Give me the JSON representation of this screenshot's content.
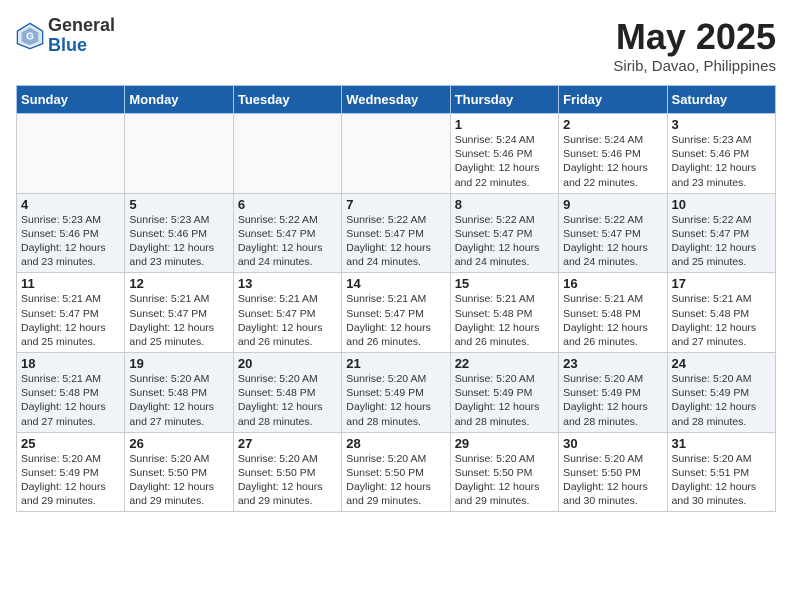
{
  "header": {
    "logo_general": "General",
    "logo_blue": "Blue",
    "month_title": "May 2025",
    "location": "Sirib, Davao, Philippines"
  },
  "days_of_week": [
    "Sunday",
    "Monday",
    "Tuesday",
    "Wednesday",
    "Thursday",
    "Friday",
    "Saturday"
  ],
  "weeks": [
    [
      {
        "day": "",
        "info": ""
      },
      {
        "day": "",
        "info": ""
      },
      {
        "day": "",
        "info": ""
      },
      {
        "day": "",
        "info": ""
      },
      {
        "day": "1",
        "info": "Sunrise: 5:24 AM\nSunset: 5:46 PM\nDaylight: 12 hours\nand 22 minutes."
      },
      {
        "day": "2",
        "info": "Sunrise: 5:24 AM\nSunset: 5:46 PM\nDaylight: 12 hours\nand 22 minutes."
      },
      {
        "day": "3",
        "info": "Sunrise: 5:23 AM\nSunset: 5:46 PM\nDaylight: 12 hours\nand 23 minutes."
      }
    ],
    [
      {
        "day": "4",
        "info": "Sunrise: 5:23 AM\nSunset: 5:46 PM\nDaylight: 12 hours\nand 23 minutes."
      },
      {
        "day": "5",
        "info": "Sunrise: 5:23 AM\nSunset: 5:46 PM\nDaylight: 12 hours\nand 23 minutes."
      },
      {
        "day": "6",
        "info": "Sunrise: 5:22 AM\nSunset: 5:47 PM\nDaylight: 12 hours\nand 24 minutes."
      },
      {
        "day": "7",
        "info": "Sunrise: 5:22 AM\nSunset: 5:47 PM\nDaylight: 12 hours\nand 24 minutes."
      },
      {
        "day": "8",
        "info": "Sunrise: 5:22 AM\nSunset: 5:47 PM\nDaylight: 12 hours\nand 24 minutes."
      },
      {
        "day": "9",
        "info": "Sunrise: 5:22 AM\nSunset: 5:47 PM\nDaylight: 12 hours\nand 24 minutes."
      },
      {
        "day": "10",
        "info": "Sunrise: 5:22 AM\nSunset: 5:47 PM\nDaylight: 12 hours\nand 25 minutes."
      }
    ],
    [
      {
        "day": "11",
        "info": "Sunrise: 5:21 AM\nSunset: 5:47 PM\nDaylight: 12 hours\nand 25 minutes."
      },
      {
        "day": "12",
        "info": "Sunrise: 5:21 AM\nSunset: 5:47 PM\nDaylight: 12 hours\nand 25 minutes."
      },
      {
        "day": "13",
        "info": "Sunrise: 5:21 AM\nSunset: 5:47 PM\nDaylight: 12 hours\nand 26 minutes."
      },
      {
        "day": "14",
        "info": "Sunrise: 5:21 AM\nSunset: 5:47 PM\nDaylight: 12 hours\nand 26 minutes."
      },
      {
        "day": "15",
        "info": "Sunrise: 5:21 AM\nSunset: 5:48 PM\nDaylight: 12 hours\nand 26 minutes."
      },
      {
        "day": "16",
        "info": "Sunrise: 5:21 AM\nSunset: 5:48 PM\nDaylight: 12 hours\nand 26 minutes."
      },
      {
        "day": "17",
        "info": "Sunrise: 5:21 AM\nSunset: 5:48 PM\nDaylight: 12 hours\nand 27 minutes."
      }
    ],
    [
      {
        "day": "18",
        "info": "Sunrise: 5:21 AM\nSunset: 5:48 PM\nDaylight: 12 hours\nand 27 minutes."
      },
      {
        "day": "19",
        "info": "Sunrise: 5:20 AM\nSunset: 5:48 PM\nDaylight: 12 hours\nand 27 minutes."
      },
      {
        "day": "20",
        "info": "Sunrise: 5:20 AM\nSunset: 5:48 PM\nDaylight: 12 hours\nand 28 minutes."
      },
      {
        "day": "21",
        "info": "Sunrise: 5:20 AM\nSunset: 5:49 PM\nDaylight: 12 hours\nand 28 minutes."
      },
      {
        "day": "22",
        "info": "Sunrise: 5:20 AM\nSunset: 5:49 PM\nDaylight: 12 hours\nand 28 minutes."
      },
      {
        "day": "23",
        "info": "Sunrise: 5:20 AM\nSunset: 5:49 PM\nDaylight: 12 hours\nand 28 minutes."
      },
      {
        "day": "24",
        "info": "Sunrise: 5:20 AM\nSunset: 5:49 PM\nDaylight: 12 hours\nand 28 minutes."
      }
    ],
    [
      {
        "day": "25",
        "info": "Sunrise: 5:20 AM\nSunset: 5:49 PM\nDaylight: 12 hours\nand 29 minutes."
      },
      {
        "day": "26",
        "info": "Sunrise: 5:20 AM\nSunset: 5:50 PM\nDaylight: 12 hours\nand 29 minutes."
      },
      {
        "day": "27",
        "info": "Sunrise: 5:20 AM\nSunset: 5:50 PM\nDaylight: 12 hours\nand 29 minutes."
      },
      {
        "day": "28",
        "info": "Sunrise: 5:20 AM\nSunset: 5:50 PM\nDaylight: 12 hours\nand 29 minutes."
      },
      {
        "day": "29",
        "info": "Sunrise: 5:20 AM\nSunset: 5:50 PM\nDaylight: 12 hours\nand 29 minutes."
      },
      {
        "day": "30",
        "info": "Sunrise: 5:20 AM\nSunset: 5:50 PM\nDaylight: 12 hours\nand 30 minutes."
      },
      {
        "day": "31",
        "info": "Sunrise: 5:20 AM\nSunset: 5:51 PM\nDaylight: 12 hours\nand 30 minutes."
      }
    ]
  ]
}
